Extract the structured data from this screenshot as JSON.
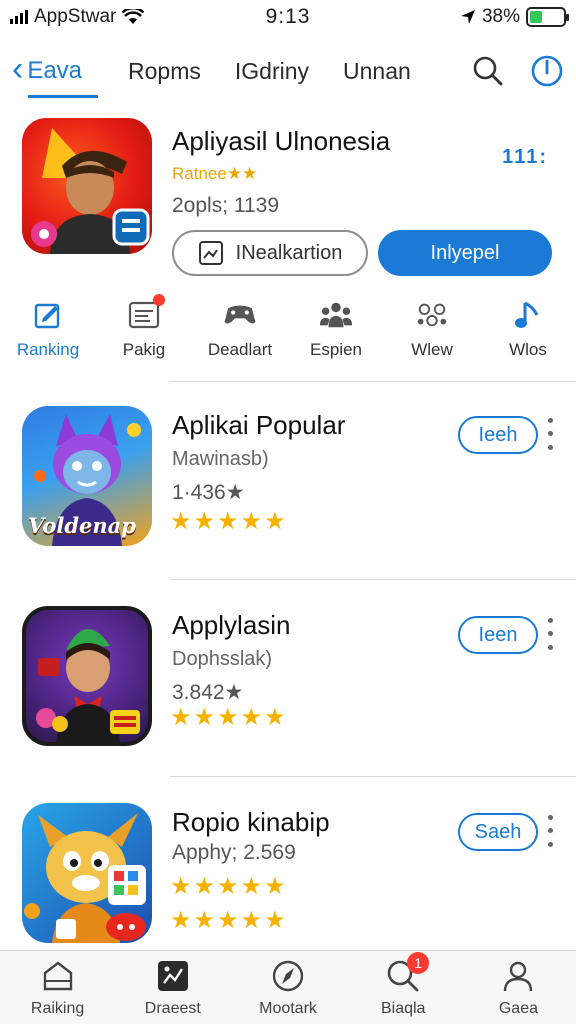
{
  "status_bar": {
    "carrier": "AppStwar",
    "time": "9:13",
    "battery": "38%",
    "battery_level": 0.38
  },
  "top_nav": {
    "back_label": "Eava",
    "tabs": [
      "Ropms",
      "IGdriny",
      "Unnan"
    ],
    "icons": [
      "search-icon",
      "power-icon"
    ]
  },
  "featured": {
    "title": "Apliyasil Ulnonesia",
    "rating_label": "Ratnee★★",
    "meta": "2opls; 1139",
    "more_label": "111:",
    "secondary_button": "INealkartion",
    "primary_button": "Inlyepel",
    "colors": {
      "accent": "#1a7ad6",
      "icon_bg": "#e21a14"
    }
  },
  "categories": [
    {
      "label": "Ranking",
      "icon": "edit-square-icon",
      "active": true
    },
    {
      "label": "Pakig",
      "icon": "list-card-icon",
      "badge": true
    },
    {
      "label": "Deadlart",
      "icon": "gamepad-icon"
    },
    {
      "label": "Espien",
      "icon": "people-icon"
    },
    {
      "label": "Wlew",
      "icon": "community-icon"
    },
    {
      "label": "Wlos",
      "icon": "music-note-icon"
    }
  ],
  "apps": [
    {
      "title": "Aplikai Popular",
      "subtitle": "Mawinasb)",
      "count": "1·436★",
      "stars_lines": [
        4.5
      ],
      "button": "Ieeh",
      "icon_text": "Voldenap",
      "icon_colors": [
        "#2f7de0",
        "#f2a21a"
      ]
    },
    {
      "title": "Applylasin",
      "subtitle": "Dophsslak)",
      "count": "3.842★",
      "stars_lines": [
        4.5
      ],
      "button": "Ieen",
      "icon_text": "",
      "icon_colors": [
        "#7a3bbf",
        "#2b1a4a"
      ]
    },
    {
      "title": "Ropio kinabip",
      "subtitle": "",
      "count": "Apphy; 2.569",
      "stars_lines": [
        4.5,
        4.5
      ],
      "button": "Saeh",
      "icon_text": "",
      "icon_colors": [
        "#2aa5e8",
        "#1c4fb0"
      ]
    }
  ],
  "tab_bar": [
    {
      "label": "Raiking",
      "icon": "home-icon"
    },
    {
      "label": "Draeest",
      "icon": "photo-icon"
    },
    {
      "label": "Mootark",
      "icon": "compass-icon"
    },
    {
      "label": "Biaqla",
      "icon": "search-icon",
      "badge": "1"
    },
    {
      "label": "Gaea",
      "icon": "person-icon"
    }
  ]
}
